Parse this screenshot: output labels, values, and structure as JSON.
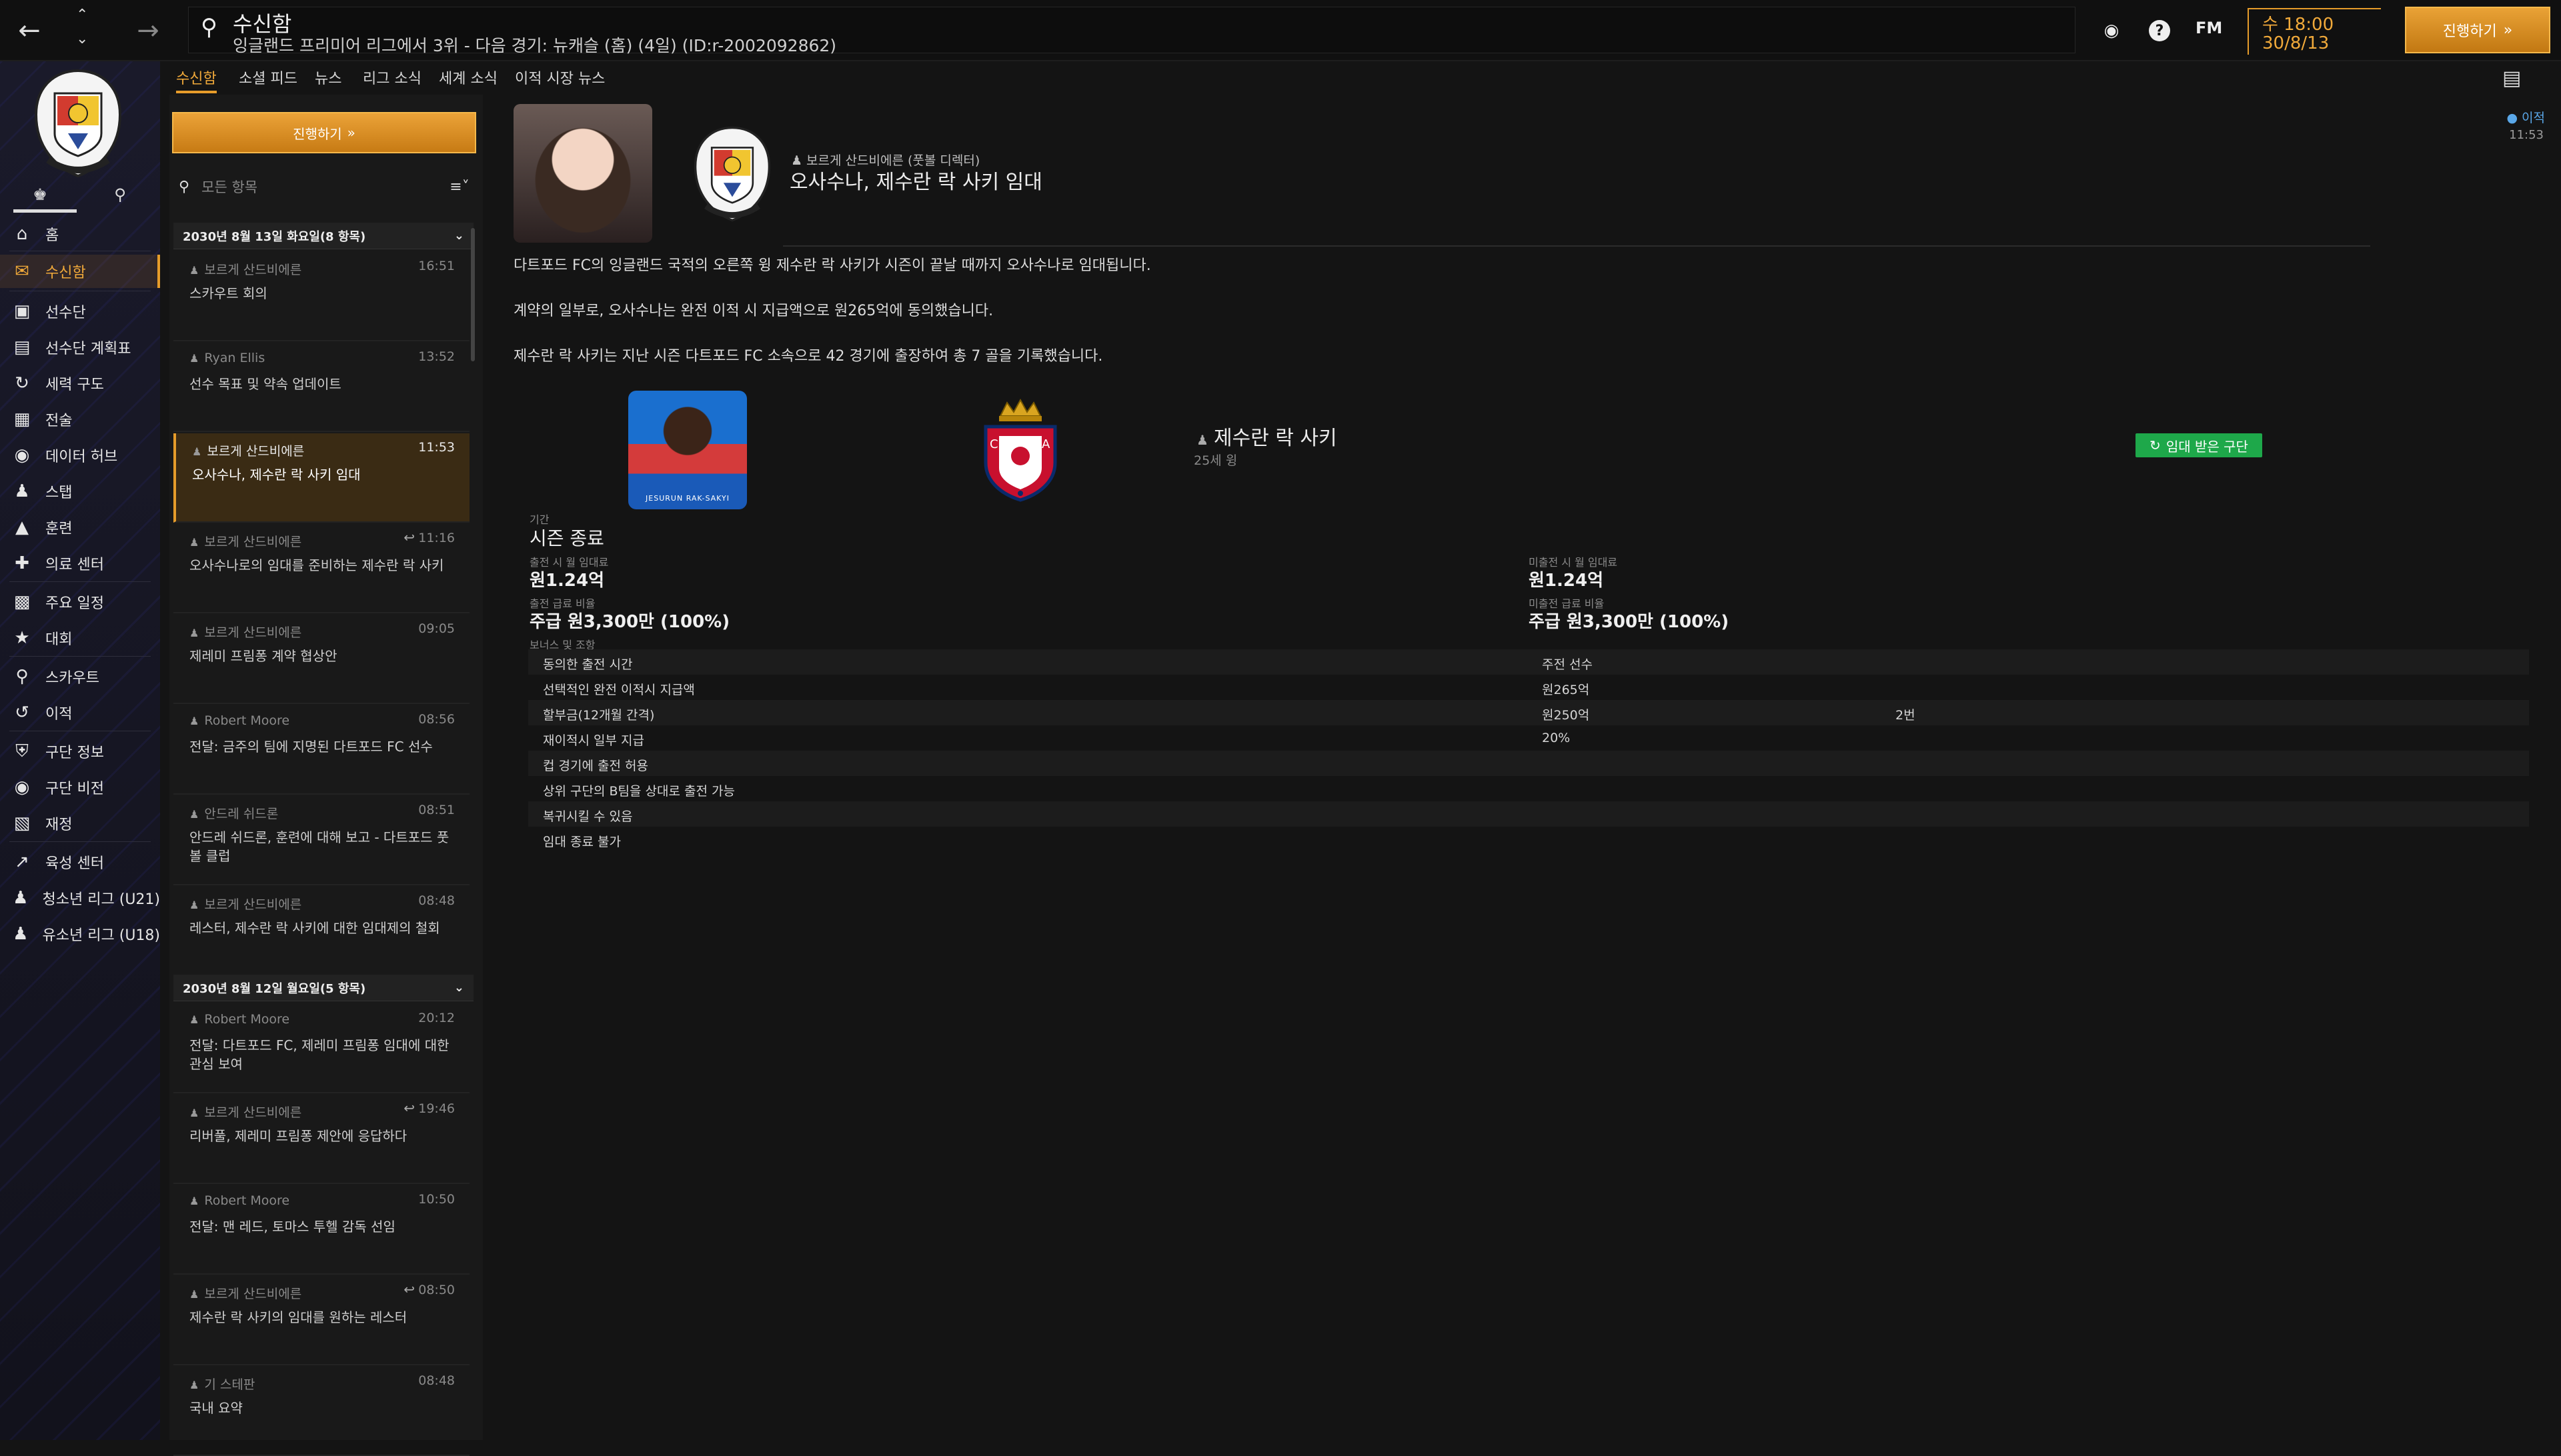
{
  "topbar": {
    "page_title": "수신함",
    "next_match": "잉글랜드 프리미어 리그에서 3위 - 다음 경기: 뉴캐슬 (홈) (4일) (ID:r-2002092862)",
    "time": "수 18:00",
    "date": "30/8/13",
    "fm_label": "FM",
    "continue_label": "진행하기"
  },
  "sidebar": {
    "items": [
      {
        "label": "홈"
      },
      {
        "label": "수신함"
      },
      {
        "label": "선수단"
      },
      {
        "label": "선수단 계획표"
      },
      {
        "label": "세력 구도"
      },
      {
        "label": "전술"
      },
      {
        "label": "데이터 허브"
      },
      {
        "label": "스탭"
      },
      {
        "label": "훈련"
      },
      {
        "label": "의료 센터"
      },
      {
        "label": "주요 일정"
      },
      {
        "label": "대회"
      },
      {
        "label": "스카우트"
      },
      {
        "label": "이적"
      },
      {
        "label": "구단 정보"
      },
      {
        "label": "구단 비전"
      },
      {
        "label": "재정"
      },
      {
        "label": "육성 센터"
      },
      {
        "label": "청소년 리그 (U21)"
      },
      {
        "label": "유소년 리그 (U18)"
      }
    ]
  },
  "subtabs": [
    "수신함",
    "소셜 피드",
    "뉴스",
    "리그 소식",
    "세계 소식",
    "이적 시장 뉴스"
  ],
  "list": {
    "continue_label": "진행하기",
    "filter_placeholder": "모든 항목",
    "group1_header": "2030년 8월 13일 화요일(8 항목)",
    "group2_header": "2030년 8월 12일 월요일(5 항목)",
    "messages": [
      {
        "sender": "보르게 산드비에른",
        "time": "16:51",
        "subject": "스카우트 회의"
      },
      {
        "sender": "Ryan Ellis",
        "time": "13:52",
        "subject": "선수 목표 및 약속 업데이트"
      },
      {
        "sender": "보르게 산드비에른",
        "time": "11:53",
        "subject": "오사수나, 제수란 락 사키 임대"
      },
      {
        "sender": "보르게 산드비에른",
        "time": "11:16",
        "subject": "오사수나로의 임대를 준비하는 제수란 락 사키"
      },
      {
        "sender": "보르게 산드비에른",
        "time": "09:05",
        "subject": "제레미 프림퐁 계약 협상안"
      },
      {
        "sender": "Robert Moore",
        "time": "08:56",
        "subject": "전달: 금주의 팀에 지명된 다트포드 FC 선수"
      },
      {
        "sender": "안드레 쉬드론",
        "time": "08:51",
        "subject": "안드레 쉬드론, 훈련에 대해 보고 - 다트포드 풋볼 클럽"
      },
      {
        "sender": "보르게 산드비에른",
        "time": "08:48",
        "subject": "레스터, 제수란 락 사키에 대한 임대제의 철회"
      },
      {
        "sender": "Robert Moore",
        "time": "20:12",
        "subject": "전달: 다트포드 FC, 제레미 프림퐁 임대에 대한 관심 보여"
      },
      {
        "sender": "보르게 산드비에른",
        "time": "19:46",
        "subject": "리버풀, 제레미 프림퐁 제안에 응답하다"
      },
      {
        "sender": "Robert Moore",
        "time": "10:50",
        "subject": "전달: 맨 레드, 토마스 투헬 감독 선임"
      },
      {
        "sender": "보르게 산드비에른",
        "time": "08:50",
        "subject": "제수란 락 사키의 임대를 원하는 레스터"
      },
      {
        "sender": "기 스테판",
        "time": "08:48",
        "subject": "국내 요약"
      }
    ]
  },
  "article": {
    "reporter_line": "보르게 산드비에른 (풋볼 디렉터)",
    "headline": "오사수나, 제수란 락 사키 임대",
    "tag": "이적",
    "tag_time": "11:53",
    "para1": "다트포드 FC의 잉글랜드 국적의 오른쪽 윙 제수란 락 사키가 시즌이 끝날 때까지 오사수나로 임대됩니다.",
    "para2": "계약의 일부로, 오사수나는 완전 이적 시 지급액으로 원265억에 동의했습니다.",
    "para3": "제수란 락 사키는 지난 시즌 다트포드 FC 소속으로 42 경기에 출장하여 총 7 골을 기록했습니다.",
    "player_name": "제수란 락 사키",
    "player_age": "25세 윙",
    "player_photo_caption": "JESURUN RAK-SAKYI",
    "loaned_badge": "임대 받은 구단",
    "duration_label": "기간",
    "duration_value": "시즌 종료",
    "fee_played_label": "출전 시 월 임대료",
    "fee_played_value": "원1.24억",
    "fee_unplayed_label": "미출전 시 월 임대료",
    "fee_unplayed_value": "원1.24억",
    "wage_played_label": "출전 급료 비율",
    "wage_played_value": "주급 원3,300만 (100%)",
    "wage_unplayed_label": "미출전 급료 비율",
    "wage_unplayed_value": "주급 원3,300만 (100%)",
    "bonus_label": "보너스 및 조항",
    "rows": [
      {
        "c1": "동의한 출전 시간",
        "c2": "주전 선수",
        "c3": ""
      },
      {
        "c1": "선택적인 완전 이적시 지급액",
        "c2": "원265억",
        "c3": ""
      },
      {
        "c1": "할부금(12개월 간격)",
        "c2": "원250억",
        "c3": "2번"
      },
      {
        "c1": "재이적시 일부 지급",
        "c2": "20%",
        "c3": ""
      },
      {
        "c1": "컵 경기에 출전 허용",
        "c2": "",
        "c3": ""
      },
      {
        "c1": "상위 구단의 B팀을 상대로 출전 가능",
        "c2": "",
        "c3": ""
      },
      {
        "c1": "복귀시킬 수 있음",
        "c2": "",
        "c3": ""
      },
      {
        "c1": "임대 종료 불가",
        "c2": "",
        "c3": ""
      }
    ]
  },
  "colors": {
    "accent": "#e69c2a",
    "loaned_green": "#1ea84a",
    "tag_blue": "#5aa7e8"
  }
}
